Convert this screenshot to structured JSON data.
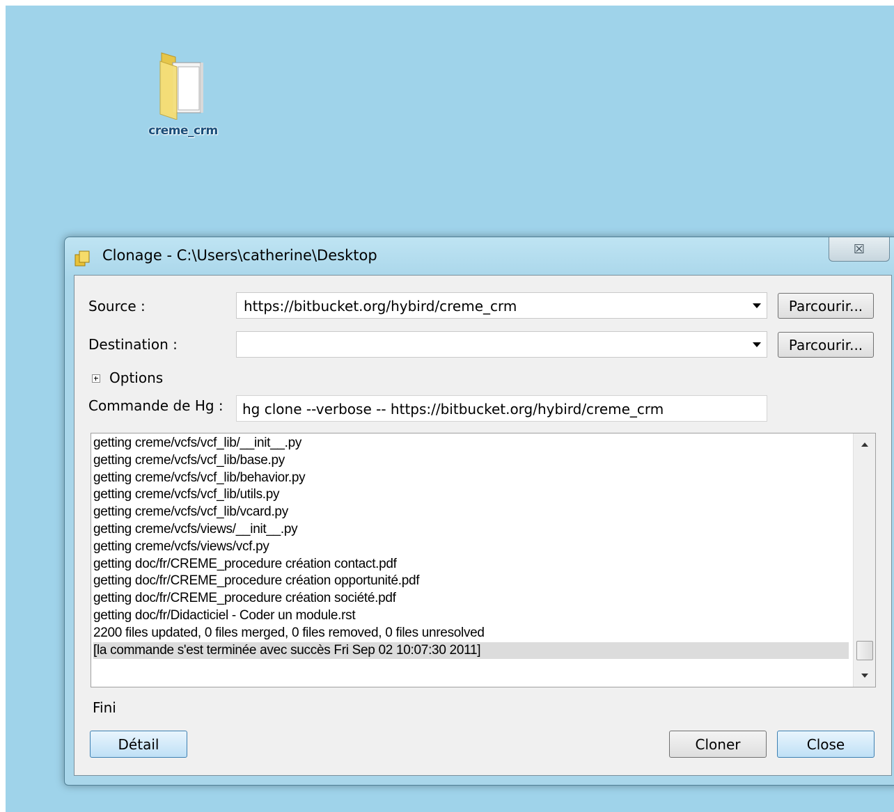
{
  "desktop": {
    "folder_icon": "folder-icon",
    "folder_label": "creme_crm"
  },
  "window": {
    "title": "Clonage - C:\\Users\\catherine\\Desktop",
    "close_glyph": "☒"
  },
  "form": {
    "source_label": "Source :",
    "source_value": "https://bitbucket.org/hybird/creme_crm",
    "destination_label": "Destination :",
    "destination_value": "",
    "browse_label": "Parcourir...",
    "options_label": "Options",
    "hg_command_label": "Commande de Hg :",
    "hg_command_value": "hg clone --verbose -- https://bitbucket.org/hybird/creme_crm"
  },
  "log": {
    "lines": [
      "getting creme/vcfs/vcf_lib/__init__.py",
      "getting creme/vcfs/vcf_lib/base.py",
      "getting creme/vcfs/vcf_lib/behavior.py",
      "getting creme/vcfs/vcf_lib/utils.py",
      "getting creme/vcfs/vcf_lib/vcard.py",
      "getting creme/vcfs/views/__init__.py",
      "getting creme/vcfs/views/vcf.py",
      "getting doc/fr/CREME_procedure création contact.pdf",
      "getting doc/fr/CREME_procedure création opportunité.pdf",
      "getting doc/fr/CREME_procedure création société.pdf",
      "getting doc/fr/Didacticiel - Coder un module.rst",
      "2200 files updated, 0 files merged, 0 files removed, 0 files unresolved",
      "[la commande s'est terminée avec succès Fri Sep 02 10:07:30 2011]"
    ],
    "selected_index": 12
  },
  "status": {
    "text": "Fini"
  },
  "buttons": {
    "detail": "Détail",
    "clone": "Cloner",
    "close": "Close"
  },
  "colors": {
    "desktop_bg": "#9fd3ea",
    "window_frame": "#a9d6ea",
    "primary_button": "#bfe0f6"
  }
}
